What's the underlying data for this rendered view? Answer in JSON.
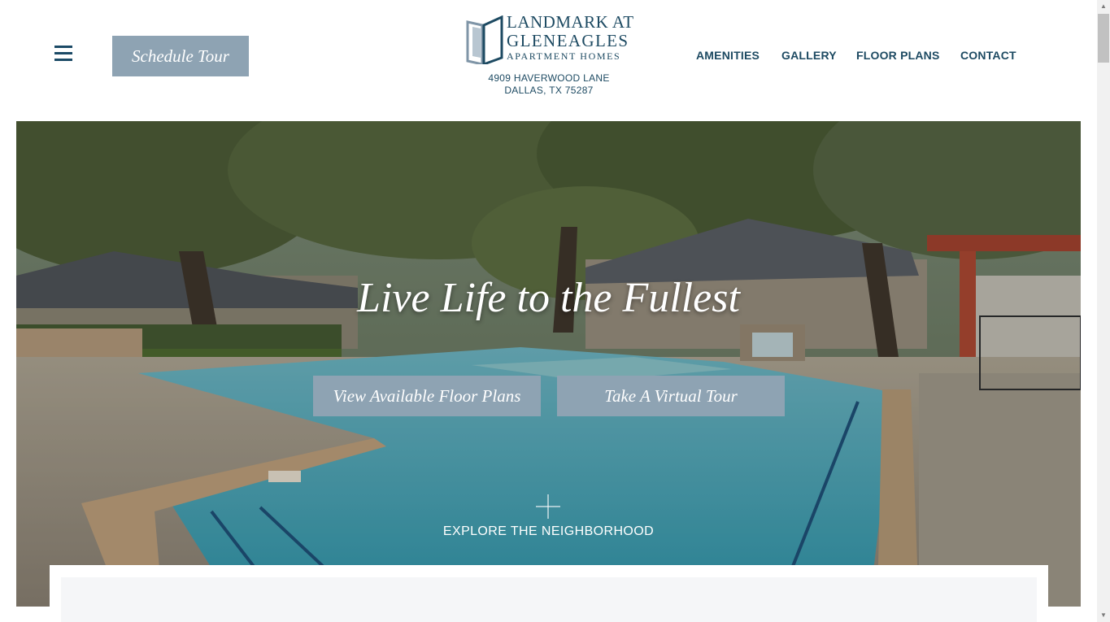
{
  "header": {
    "menu_icon": "hamburger-menu-icon",
    "schedule_label": "Schedule Tour",
    "logo": {
      "line1": "LANDMARK AT",
      "line2": "GLENEAGLES",
      "line3": "APARTMENT HOMES"
    },
    "address_line1": "4909 HAVERWOOD LANE",
    "address_line2": "DALLAS, TX 75287"
  },
  "nav": [
    {
      "label": "AMENITIES"
    },
    {
      "label": "GALLERY"
    },
    {
      "label": "FLOOR PLANS"
    },
    {
      "label": "CONTACT"
    }
  ],
  "hero": {
    "title": "Live Life to the Fullest",
    "buttons": {
      "floor_plans": "View Available Floor Plans",
      "virtual_tour": "Take A Virtual Tour"
    },
    "explore_label": "EXPLORE THE NEIGHBORHOOD"
  },
  "colors": {
    "brand_navy": "#1d4a62",
    "button_slate": "#8ea3b3"
  }
}
